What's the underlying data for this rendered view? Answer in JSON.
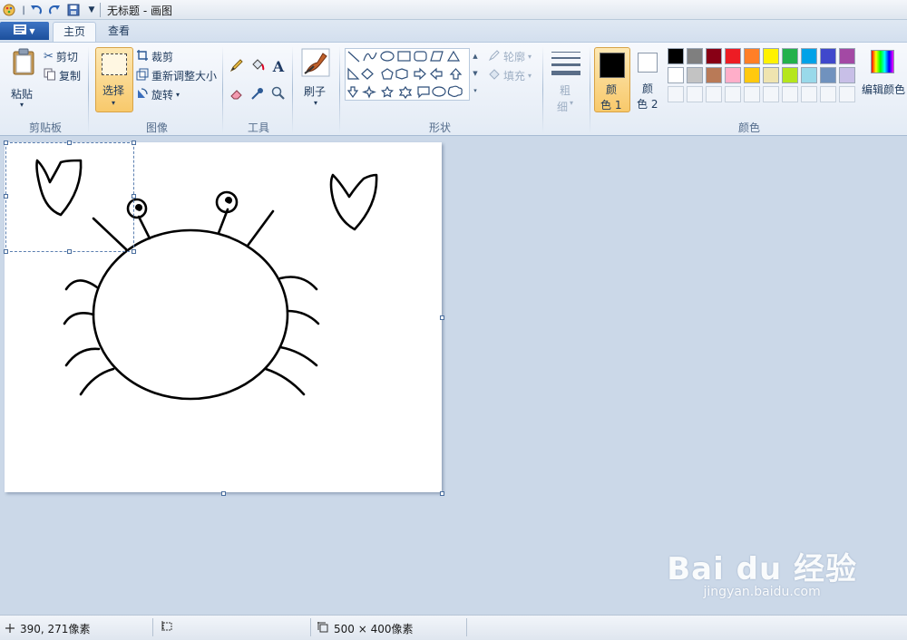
{
  "titlebar": {
    "title": "无标题 - 画图",
    "quick_access": [
      "paint-app-icon",
      "undo-icon",
      "redo-icon",
      "save-icon",
      "customize-dropdown-icon"
    ]
  },
  "tabs": {
    "file_icon": "paint-menu-icon",
    "home": "主页",
    "view": "查看"
  },
  "clipboard": {
    "paste": "粘贴",
    "cut": "剪切",
    "copy": "复制",
    "group": "剪贴板"
  },
  "image": {
    "select": "选择",
    "crop": "裁剪",
    "resize": "重新调整大小",
    "rotate": "旋转",
    "group": "图像"
  },
  "tools": {
    "group": "工具",
    "items": [
      "pencil-icon",
      "fill-bucket-icon",
      "text-icon",
      "eraser-icon",
      "color-picker-icon",
      "magnifier-icon"
    ]
  },
  "brushes": {
    "label": "刷子"
  },
  "shapes": {
    "outline": "轮廓",
    "fill": "填充",
    "group": "形状"
  },
  "size": {
    "label_line1": "粗",
    "label_line2": "细"
  },
  "colors": {
    "color1_line1": "颜",
    "color1_line2": "色 1",
    "color2_line1": "颜",
    "color2_line2": "色 2",
    "edit": "编辑颜色",
    "group": "颜色",
    "color1_value": "#000000",
    "color2_value": "#ffffff",
    "palette_row1": [
      "#000000",
      "#7f7f7f",
      "#880015",
      "#ed1c24",
      "#ff7f27",
      "#fff200",
      "#22b14c",
      "#00a2e8",
      "#3f48cc",
      "#a349a4"
    ],
    "palette_row2": [
      "#ffffff",
      "#c3c3c3",
      "#b97a57",
      "#ffaec9",
      "#ffc90e",
      "#efe4b0",
      "#b5e61d",
      "#99d9ea",
      "#7092be",
      "#c8bfe7"
    ]
  },
  "statusbar": {
    "cursor_pos": "390, 271像素",
    "canvas_size": "500 × 400像素"
  },
  "watermark": {
    "logo": "Bai du 经验",
    "url": "jingyan.baidu.com"
  }
}
